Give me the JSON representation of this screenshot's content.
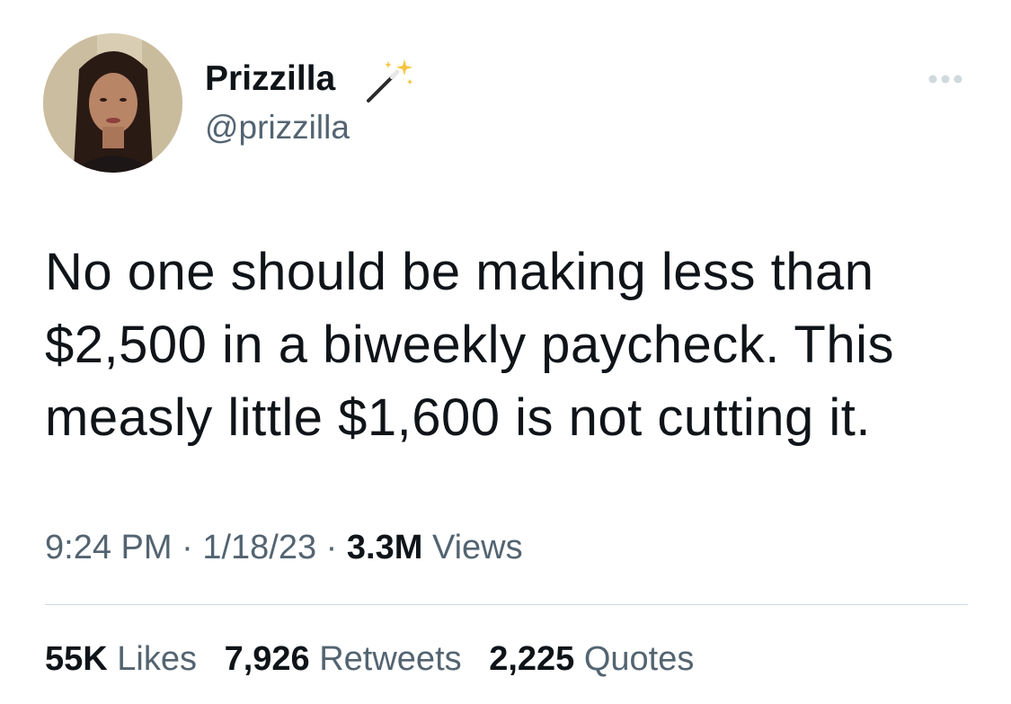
{
  "author": {
    "display_name": "Prizzilla",
    "handle": "@prizzilla",
    "name_emoji": "magic-wand-icon"
  },
  "tweet": {
    "text": "No one should be making less than $2,500 in a biweekly paycheck. This measly little $1,600 is not cutting it.",
    "time": "9:24 PM",
    "date": "1/18/23",
    "separator": "·",
    "views_count": "3.3M",
    "views_label": "Views"
  },
  "stats": {
    "likes_count": "55K",
    "likes_label": "Likes",
    "retweets_count": "7,926",
    "retweets_label": "Retweets",
    "quotes_count": "2,225",
    "quotes_label": "Quotes"
  },
  "colors": {
    "text_primary": "#0f1419",
    "text_secondary": "#536471",
    "divider": "#cfd9de"
  }
}
